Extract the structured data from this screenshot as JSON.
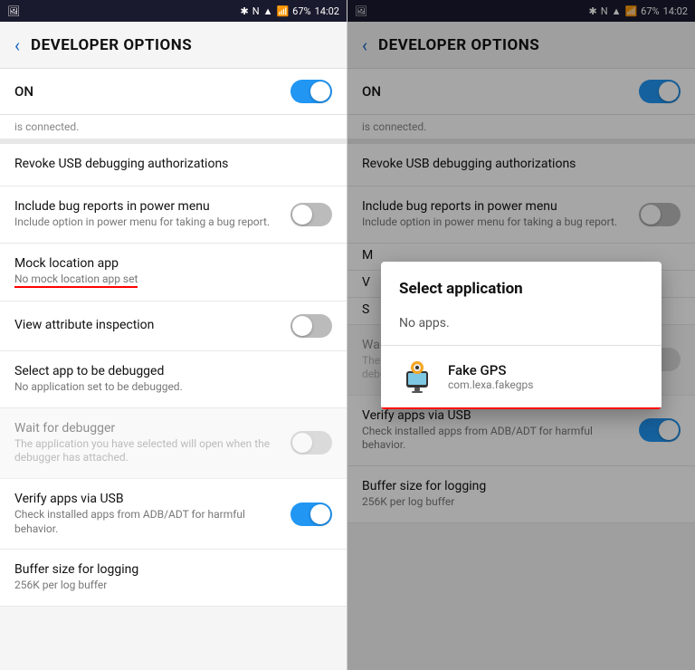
{
  "panels": {
    "left": {
      "statusBar": {
        "left": "📷",
        "icons": "🔇 📶 67% 14:02"
      },
      "toolbar": {
        "back": "<",
        "title": "DEVELOPER OPTIONS"
      },
      "on": {
        "label": "ON",
        "toggleState": "on"
      },
      "connectedText": "is connected.",
      "settings": [
        {
          "id": "revoke-usb",
          "title": "Revoke USB debugging authorizations",
          "subtitle": "",
          "hasToggle": false,
          "toggleState": "off",
          "disabled": false
        },
        {
          "id": "bug-reports",
          "title": "Include bug reports in power menu",
          "subtitle": "Include option in power menu for taking a bug report.",
          "hasToggle": true,
          "toggleState": "off",
          "disabled": false
        },
        {
          "id": "mock-location",
          "title": "Mock location app",
          "subtitle": "No mock location app set",
          "hasToggle": false,
          "toggleState": "off",
          "disabled": false,
          "redUnderline": true
        },
        {
          "id": "view-attribute",
          "title": "View attribute inspection",
          "subtitle": "",
          "hasToggle": true,
          "toggleState": "off",
          "disabled": false
        },
        {
          "id": "select-app-debug",
          "title": "Select app to be debugged",
          "subtitle": "No application set to be debugged.",
          "hasToggle": false,
          "toggleState": "off",
          "disabled": false
        },
        {
          "id": "wait-for-debugger",
          "title": "Wait for debugger",
          "subtitle": "The application you have selected will open when the debugger has attached.",
          "hasToggle": true,
          "toggleState": "off",
          "disabled": true
        },
        {
          "id": "verify-apps-usb",
          "title": "Verify apps via USB",
          "subtitle": "Check installed apps from ADB/ADT for harmful behavior.",
          "hasToggle": true,
          "toggleState": "on",
          "disabled": false
        },
        {
          "id": "buffer-logging",
          "title": "Buffer size for logging",
          "subtitle": "256K per log buffer",
          "hasToggle": false,
          "toggleState": "off",
          "disabled": false
        }
      ]
    },
    "right": {
      "statusBar": {
        "left": "📷",
        "icons": "🔇 📶 67% 14:02"
      },
      "toolbar": {
        "back": "<",
        "title": "DEVELOPER OPTIONS"
      },
      "on": {
        "label": "ON",
        "toggleState": "on"
      },
      "connectedText": "is connected.",
      "settings": [
        {
          "id": "revoke-usb",
          "title": "Revoke USB debugging authorizations",
          "subtitle": "",
          "hasToggle": false,
          "toggleState": "off",
          "disabled": false
        },
        {
          "id": "bug-reports",
          "title": "Include bug reports in power menu",
          "subtitle": "Include option in power menu for taking a bug report.",
          "hasToggle": true,
          "toggleState": "off",
          "disabled": false
        },
        {
          "id": "mock-location",
          "title": "M",
          "subtitle": "",
          "hasToggle": false,
          "toggleState": "off",
          "disabled": false
        },
        {
          "id": "view-attribute",
          "title": "V",
          "subtitle": "",
          "hasToggle": true,
          "toggleState": "off",
          "disabled": false
        },
        {
          "id": "select-app-debug",
          "title": "S",
          "subtitle": "",
          "hasToggle": false,
          "toggleState": "off",
          "disabled": false
        },
        {
          "id": "wait-for-debugger",
          "title": "Wait for debugger",
          "subtitle": "The application you have selected will open when the debugger has attached.",
          "hasToggle": true,
          "toggleState": "off",
          "disabled": true
        },
        {
          "id": "verify-apps-usb",
          "title": "Verify apps via USB",
          "subtitle": "Check installed apps from ADB/ADT for harmful behavior.",
          "hasToggle": true,
          "toggleState": "on",
          "disabled": false
        },
        {
          "id": "buffer-logging",
          "title": "Buffer size for logging",
          "subtitle": "256K per log buffer",
          "hasToggle": false,
          "toggleState": "off",
          "disabled": false
        }
      ],
      "dialog": {
        "title": "Select application",
        "noAppsText": "No apps.",
        "apps": [
          {
            "name": "Fake GPS",
            "package": "com.lexa.fakegps",
            "icon": "🚗"
          }
        ]
      }
    }
  }
}
